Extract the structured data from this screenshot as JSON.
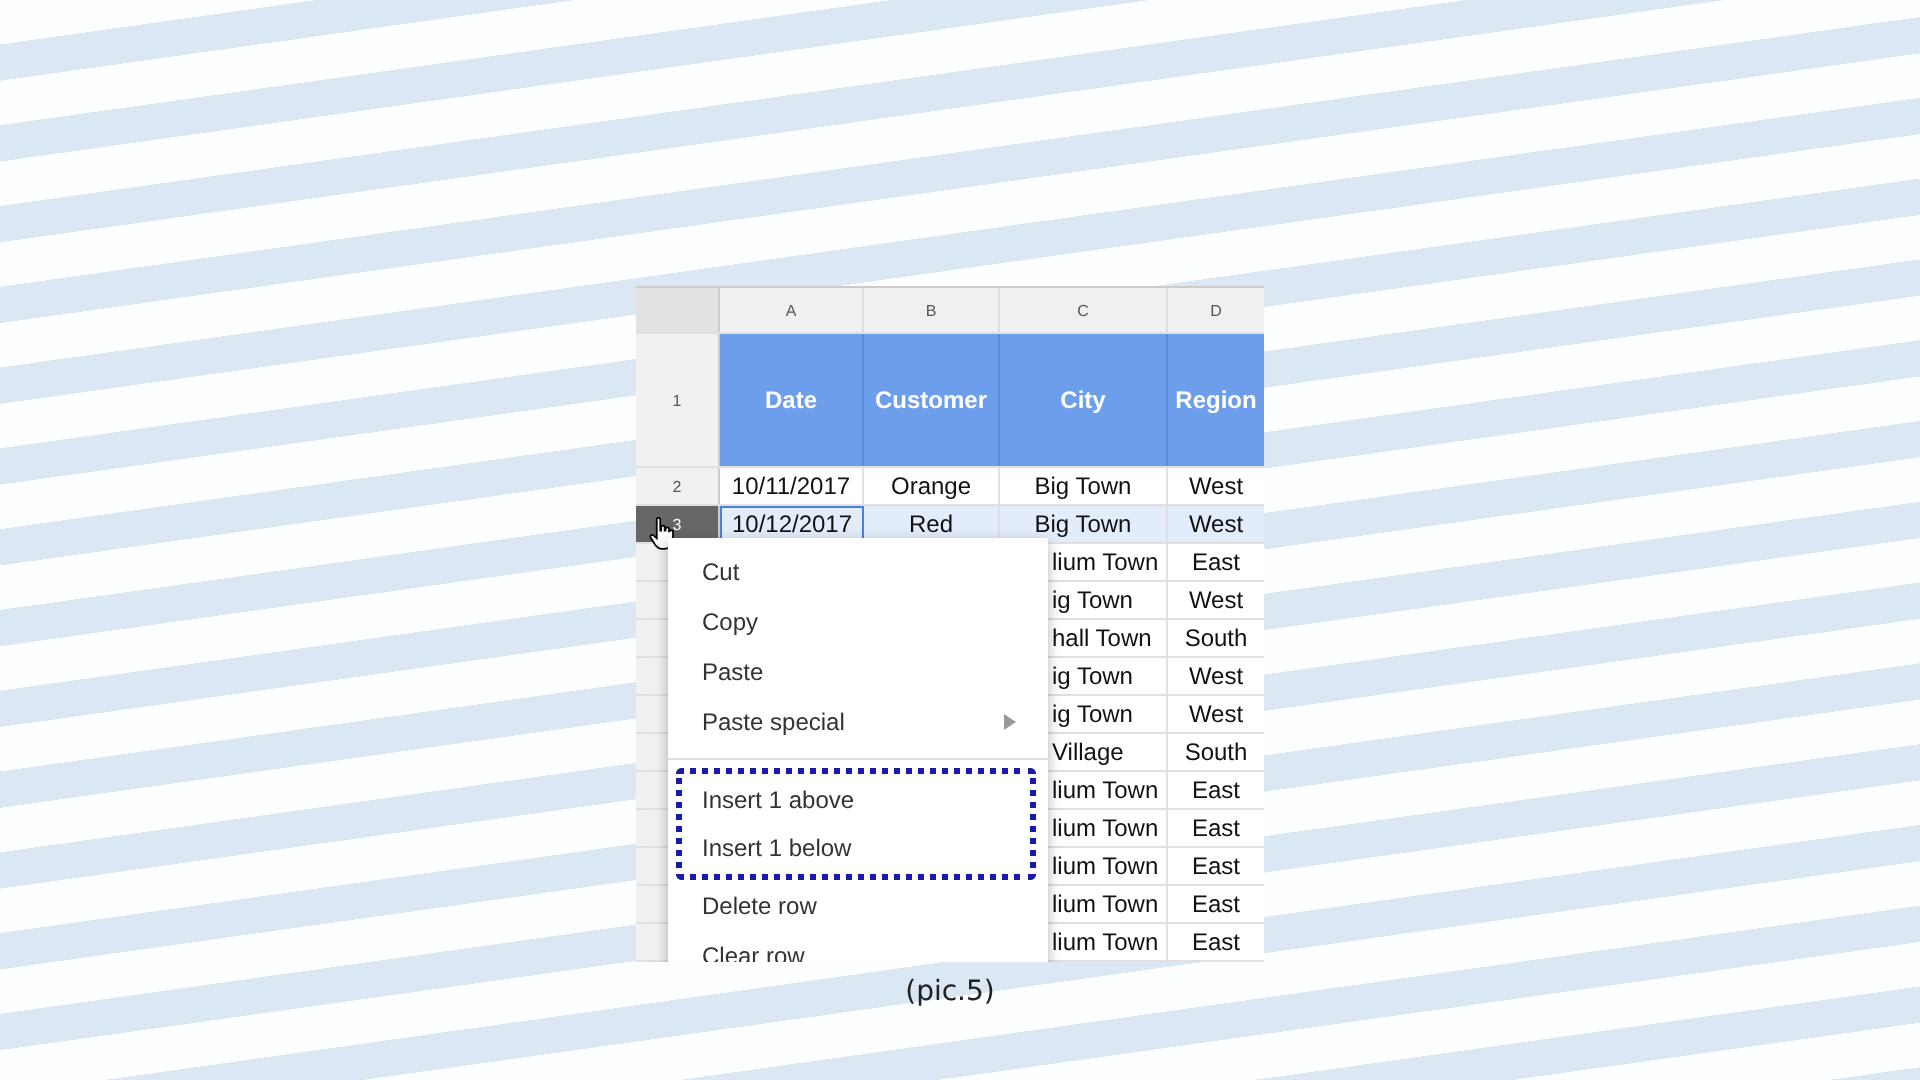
{
  "sheet": {
    "columns": [
      "A",
      "B",
      "C",
      "D"
    ],
    "header_row": {
      "number": "1",
      "cells": [
        "Date",
        "Customer",
        "City",
        "Region"
      ]
    },
    "rows": [
      {
        "number": "2",
        "selected": false,
        "cells": [
          "10/11/2017",
          "Orange",
          "Big Town",
          "West"
        ]
      },
      {
        "number": "3",
        "selected": true,
        "cells": [
          "10/12/2017",
          "Red",
          "Big Town",
          "West"
        ]
      }
    ],
    "covered_rows": [
      {
        "city": "lium Town",
        "region": "East"
      },
      {
        "city": "ig Town",
        "region": "West"
      },
      {
        "city": "hall Town",
        "region": "South"
      },
      {
        "city": "ig Town",
        "region": "West"
      },
      {
        "city": "ig Town",
        "region": "West"
      },
      {
        "city": "Village",
        "region": "South"
      },
      {
        "city": "lium Town",
        "region": "East"
      },
      {
        "city": "lium Town",
        "region": "East"
      },
      {
        "city": "lium Town",
        "region": "East"
      },
      {
        "city": "lium Town",
        "region": "East"
      },
      {
        "city": "lium Town",
        "region": "East"
      }
    ]
  },
  "context_menu": {
    "items": [
      {
        "kind": "item",
        "label": "Cut",
        "boxed": false
      },
      {
        "kind": "item",
        "label": "Copy",
        "boxed": false
      },
      {
        "kind": "item",
        "label": "Paste",
        "boxed": false
      },
      {
        "kind": "submenu",
        "label": "Paste special",
        "boxed": false
      },
      {
        "kind": "divider"
      },
      {
        "kind": "item",
        "label": "Insert 1 above",
        "boxed": true
      },
      {
        "kind": "item",
        "label": "Insert 1 below",
        "boxed": true
      },
      {
        "kind": "item",
        "label": "Delete row",
        "boxed": false
      },
      {
        "kind": "item",
        "label": "Clear row",
        "boxed": false
      }
    ]
  },
  "caption": "(pic.5)"
}
